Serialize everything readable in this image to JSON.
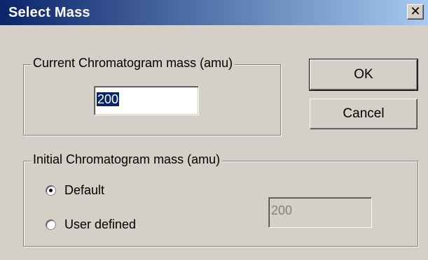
{
  "window": {
    "title": "Select Mass",
    "close_glyph": "✕",
    "close_icon": "close-icon"
  },
  "current_group": {
    "legend": "Current Chromatogram mass (amu)",
    "input_value": "200"
  },
  "buttons": {
    "ok_label": "OK",
    "cancel_label": "Cancel"
  },
  "initial_group": {
    "legend": "Initial Chromatogram mass (amu)",
    "options": [
      {
        "label": "Default",
        "selected": true
      },
      {
        "label": "User defined",
        "selected": false
      }
    ],
    "user_value": "200"
  },
  "colors": {
    "title_start": "#0a246a",
    "title_end": "#a6caf0",
    "selection": "#0a246a",
    "face": "#d4d0c8"
  }
}
